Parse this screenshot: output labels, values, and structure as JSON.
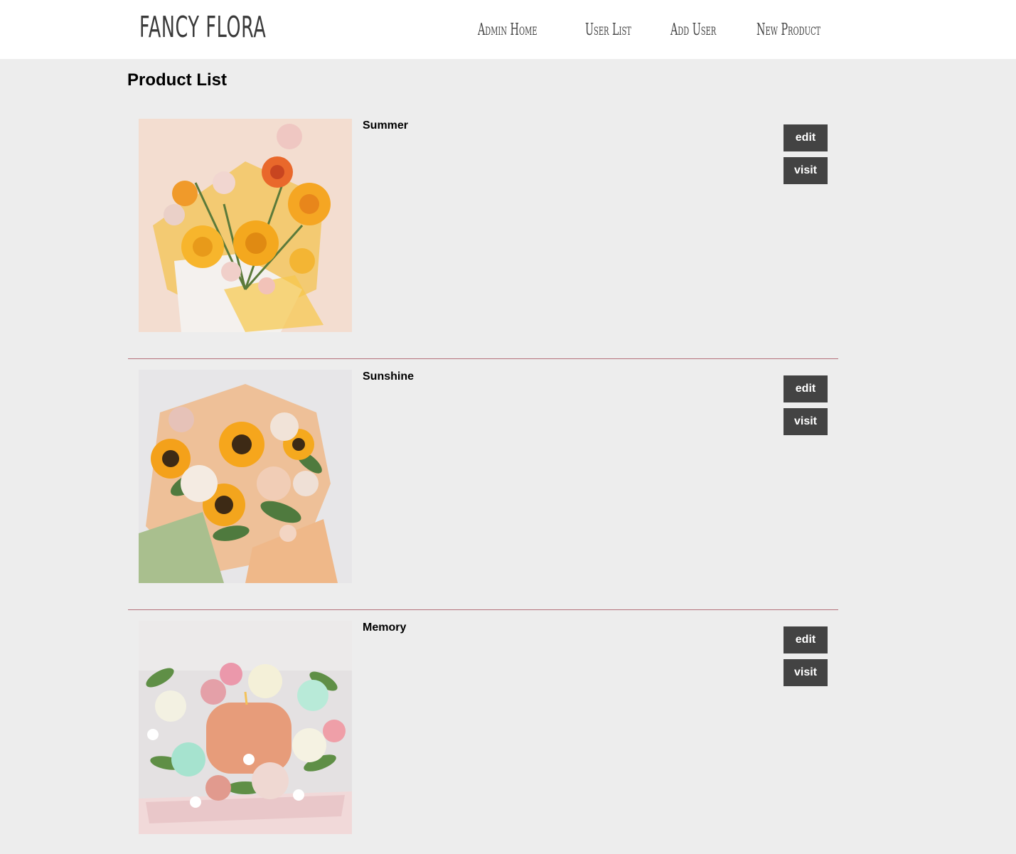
{
  "header": {
    "logo": "FANCY FLORA",
    "nav": [
      "Admin Home",
      "User List",
      "Add User",
      "New Product"
    ]
  },
  "page_title": "Product List",
  "products": [
    {
      "name": "Summer",
      "image": "summer-bouquet-photo",
      "edit_label": "edit",
      "visit_label": "visit"
    },
    {
      "name": "Sunshine",
      "image": "sunflower-bouquet-photo",
      "edit_label": "edit",
      "visit_label": "visit"
    },
    {
      "name": "Memory",
      "image": "flower-box-photo",
      "edit_label": "edit",
      "visit_label": "visit"
    }
  ],
  "colors": {
    "header_bg": "#ffffff",
    "page_bg": "#ededed",
    "button_bg": "#434343",
    "divider": "#b5717a"
  }
}
